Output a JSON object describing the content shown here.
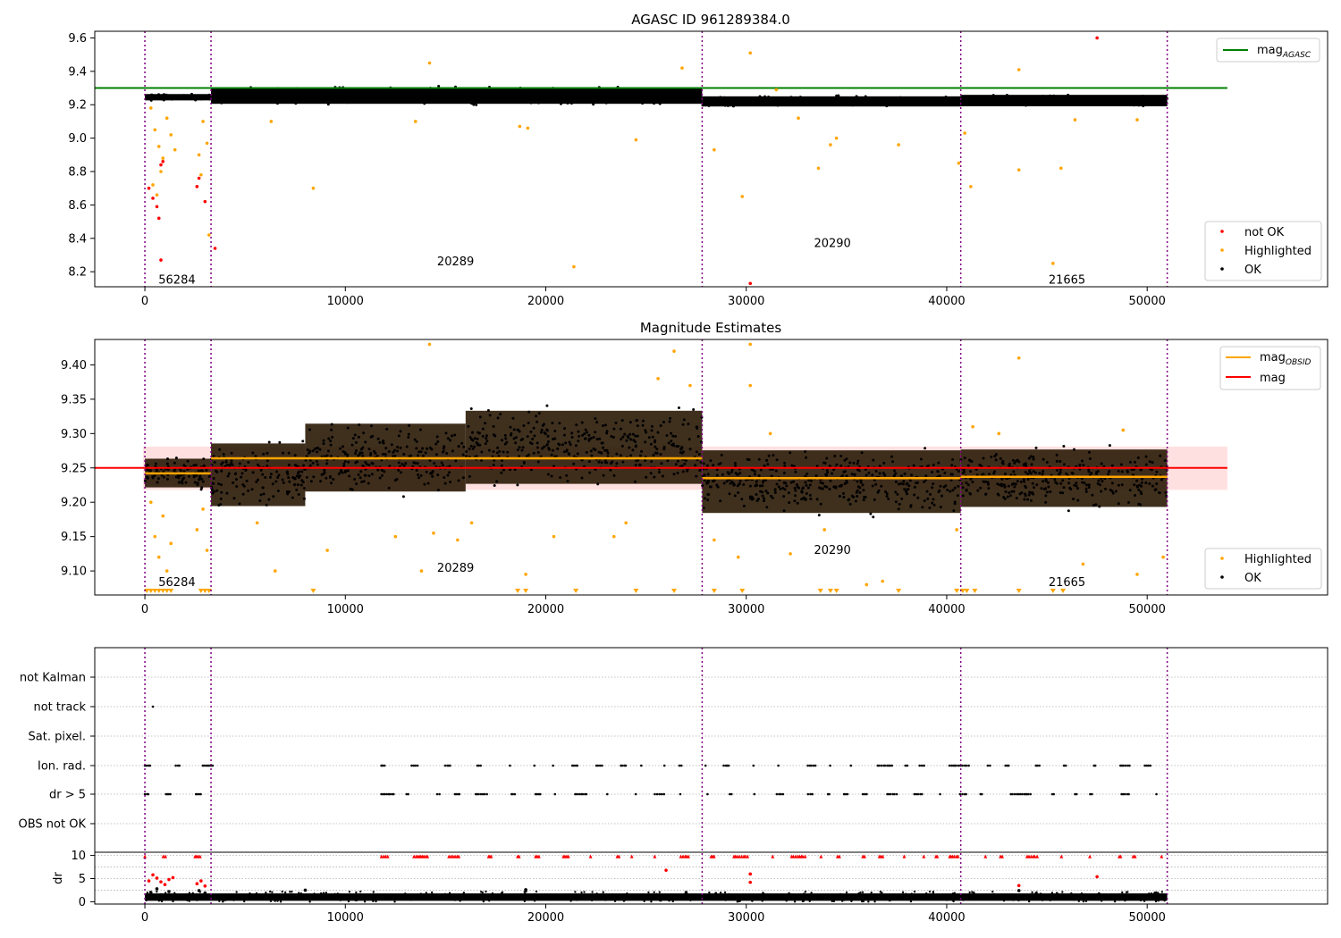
{
  "colors": {
    "ok": "#000000",
    "highlighted": "#ffa500",
    "not_ok": "#ff0000",
    "agasc_line": "#008000",
    "mag_line": "#ff0000",
    "mag_obsid_line": "#ffa500",
    "obs_boundary": "#800080",
    "grid": "#b0b0b0"
  },
  "chart_data": [
    {
      "type": "scatter",
      "title": "AGASC ID 961289384.0",
      "xlim": [
        -2500,
        59000
      ],
      "ylim": [
        8.11,
        9.64
      ],
      "xticks": [
        0,
        10000,
        20000,
        30000,
        40000,
        50000
      ],
      "yticks": [
        8.2,
        8.4,
        8.6,
        8.8,
        9.0,
        9.2,
        9.4,
        9.6
      ],
      "mag_agasc": 9.3,
      "obs_boundaries": [
        0,
        3300,
        27800,
        40700,
        51000
      ],
      "obs_labels": [
        {
          "text": "56284",
          "x": 1600,
          "y": 8.15
        },
        {
          "text": "20289",
          "x": 15500,
          "y": 8.26
        },
        {
          "text": "20290",
          "x": 34300,
          "y": 8.37
        },
        {
          "text": "21665",
          "x": 46000,
          "y": 8.15
        }
      ],
      "legend_top": [
        {
          "label": "mag",
          "sub": "AGASC"
        }
      ],
      "legend_bottom": [
        {
          "label": "not OK",
          "key": "not_ok"
        },
        {
          "label": "Highlighted",
          "key": "highlighted"
        },
        {
          "label": "OK",
          "key": "ok"
        }
      ],
      "ok_bands": [
        {
          "x0": 0,
          "x1": 3300,
          "ylo": 9.22,
          "yhi": 9.27
        },
        {
          "x0": 3300,
          "x1": 27800,
          "ylo": 9.19,
          "yhi": 9.32
        },
        {
          "x0": 27800,
          "x1": 40700,
          "ylo": 9.18,
          "yhi": 9.26
        },
        {
          "x0": 40700,
          "x1": 51000,
          "ylo": 9.18,
          "yhi": 9.27
        }
      ],
      "highlighted_points": [
        [
          300,
          9.18
        ],
        [
          500,
          9.05
        ],
        [
          700,
          8.95
        ],
        [
          900,
          8.88
        ],
        [
          1100,
          9.12
        ],
        [
          400,
          8.72
        ],
        [
          800,
          8.8
        ],
        [
          1300,
          9.02
        ],
        [
          600,
          8.66
        ],
        [
          1500,
          8.93
        ],
        [
          2700,
          8.9
        ],
        [
          2900,
          9.1
        ],
        [
          3100,
          8.97
        ],
        [
          2800,
          8.78
        ],
        [
          3200,
          8.42
        ],
        [
          6300,
          9.1
        ],
        [
          8400,
          8.7
        ],
        [
          13500,
          9.1
        ],
        [
          14200,
          9.45
        ],
        [
          18700,
          9.07
        ],
        [
          19100,
          9.06
        ],
        [
          21400,
          8.23
        ],
        [
          24500,
          8.99
        ],
        [
          26800,
          9.42
        ],
        [
          28400,
          8.93
        ],
        [
          29800,
          8.65
        ],
        [
          30200,
          9.51
        ],
        [
          31500,
          9.29
        ],
        [
          32600,
          9.12
        ],
        [
          33600,
          8.82
        ],
        [
          34200,
          8.96
        ],
        [
          34500,
          9.0
        ],
        [
          37600,
          8.96
        ],
        [
          40600,
          8.85
        ],
        [
          40900,
          9.03
        ],
        [
          41200,
          8.71
        ],
        [
          43600,
          9.41
        ],
        [
          43600,
          8.81
        ],
        [
          45300,
          8.25
        ],
        [
          45700,
          8.82
        ],
        [
          46400,
          9.11
        ],
        [
          49500,
          9.11
        ]
      ],
      "not_ok_points": [
        [
          200,
          8.7
        ],
        [
          400,
          8.64
        ],
        [
          600,
          8.59
        ],
        [
          700,
          8.52
        ],
        [
          800,
          8.84
        ],
        [
          900,
          8.86
        ],
        [
          800,
          8.27
        ],
        [
          2600,
          8.71
        ],
        [
          2700,
          8.76
        ],
        [
          3000,
          8.62
        ],
        [
          3500,
          8.34
        ],
        [
          30200,
          8.13
        ],
        [
          47500,
          9.6
        ]
      ]
    },
    {
      "type": "scatter",
      "title": "Magnitude Estimates",
      "xlim": [
        -2500,
        59000
      ],
      "ylim": [
        9.065,
        9.437
      ],
      "xticks": [
        0,
        10000,
        20000,
        30000,
        40000,
        50000
      ],
      "yticks": [
        9.1,
        9.15,
        9.2,
        9.25,
        9.3,
        9.35,
        9.4
      ],
      "mag": 9.25,
      "mag_band": [
        9.218,
        9.281
      ],
      "mag_obsid_segments": [
        {
          "x0": 0,
          "x1": 3300,
          "y": 9.242
        },
        {
          "x0": 3300,
          "x1": 27800,
          "y": 9.264
        },
        {
          "x0": 27800,
          "x1": 40700,
          "y": 9.235
        },
        {
          "x0": 40700,
          "x1": 51000,
          "y": 9.237
        }
      ],
      "obs_boundaries": [
        0,
        3300,
        27800,
        40700,
        51000
      ],
      "obs_labels": [
        {
          "text": "56284",
          "x": 1600,
          "y": 9.083
        },
        {
          "text": "20289",
          "x": 15500,
          "y": 9.104
        },
        {
          "text": "20290",
          "x": 34300,
          "y": 9.13
        },
        {
          "text": "21665",
          "x": 46000,
          "y": 9.083
        }
      ],
      "legend_top": [
        {
          "label": "mag",
          "sub": "OBSID",
          "key": "mag_obsid_line"
        },
        {
          "label": "mag",
          "sub": "",
          "key": "mag_line"
        }
      ],
      "legend_bottom": [
        {
          "label": "Highlighted",
          "key": "highlighted"
        },
        {
          "label": "OK",
          "key": "ok"
        }
      ],
      "ok_bands": [
        {
          "x0": 0,
          "x1": 3300,
          "ylo": 9.215,
          "yhi": 9.27
        },
        {
          "x0": 3300,
          "x1": 8000,
          "ylo": 9.18,
          "yhi": 9.3
        },
        {
          "x0": 8000,
          "x1": 16000,
          "ylo": 9.2,
          "yhi": 9.33
        },
        {
          "x0": 16000,
          "x1": 27800,
          "ylo": 9.21,
          "yhi": 9.35
        },
        {
          "x0": 27800,
          "x1": 40700,
          "ylo": 9.17,
          "yhi": 9.29
        },
        {
          "x0": 40700,
          "x1": 51000,
          "ylo": 9.18,
          "yhi": 9.29
        }
      ],
      "highlighted_points": [
        [
          300,
          9.2
        ],
        [
          500,
          9.15
        ],
        [
          700,
          9.12
        ],
        [
          900,
          9.18
        ],
        [
          1100,
          9.1
        ],
        [
          1300,
          9.14
        ],
        [
          2600,
          9.16
        ],
        [
          2900,
          9.19
        ],
        [
          3100,
          9.13
        ],
        [
          5600,
          9.17
        ],
        [
          6500,
          9.1
        ],
        [
          9100,
          9.13
        ],
        [
          12500,
          9.15
        ],
        [
          13800,
          9.1
        ],
        [
          14200,
          9.43
        ],
        [
          14400,
          9.155
        ],
        [
          15600,
          9.145
        ],
        [
          16300,
          9.17
        ],
        [
          19000,
          9.095
        ],
        [
          20400,
          9.15
        ],
        [
          23400,
          9.15
        ],
        [
          24000,
          9.17
        ],
        [
          25600,
          9.38
        ],
        [
          26400,
          9.42
        ],
        [
          27200,
          9.37
        ],
        [
          28400,
          9.145
        ],
        [
          29600,
          9.12
        ],
        [
          30200,
          9.43
        ],
        [
          30200,
          9.37
        ],
        [
          31200,
          9.3
        ],
        [
          32200,
          9.125
        ],
        [
          33900,
          9.16
        ],
        [
          36000,
          9.08
        ],
        [
          36800,
          9.085
        ],
        [
          40500,
          9.16
        ],
        [
          41300,
          9.31
        ],
        [
          42600,
          9.3
        ],
        [
          43600,
          9.41
        ],
        [
          46800,
          9.11
        ],
        [
          48800,
          9.305
        ],
        [
          49500,
          9.095
        ],
        [
          50800,
          9.12
        ]
      ],
      "clip_markers": [
        100,
        300,
        500,
        700,
        900,
        1100,
        1300,
        2800,
        3000,
        3200,
        8400,
        18600,
        19000,
        21500,
        24500,
        26400,
        28400,
        29800,
        33700,
        34200,
        34500,
        37600,
        40500,
        40800,
        41000,
        41400,
        43600,
        45300,
        45800
      ]
    },
    {
      "type": "scatter",
      "title": "",
      "xlim": [
        -2500,
        59000
      ],
      "xticks": [
        0,
        10000,
        20000,
        30000,
        40000,
        50000
      ],
      "flag_categories": [
        "not Kalman",
        "not track",
        "Sat. pixel.",
        "Ion. rad.",
        "dr > 5",
        "OBS not OK"
      ],
      "flag_points": [
        {
          "flag": "not track",
          "x": [
            400
          ]
        },
        {
          "flag": "Ion. rad.",
          "ranges": [
            [
              0,
              3700
            ],
            [
              11800,
              51000
            ]
          ]
        },
        {
          "flag": "dr > 5",
          "ranges": [
            [
              0,
              3700
            ],
            [
              11800,
              51000
            ]
          ]
        }
      ],
      "dr_ylabel": "dr",
      "dr_yticks": [
        0,
        5,
        10
      ],
      "dr_ylim": [
        -0.5,
        10.5
      ],
      "dr_ok_band": {
        "x0": 0,
        "x1": 51000,
        "ylo": 0.2,
        "yhi": 1.8
      },
      "dr_saturated_y": 9.8,
      "dr_saturated_ranges": [
        [
          0,
          3700
        ],
        [
          11800,
          51000
        ]
      ],
      "dr_red_points": [
        [
          200,
          4.5
        ],
        [
          400,
          5.8
        ],
        [
          600,
          5.1
        ],
        [
          800,
          4.3
        ],
        [
          1000,
          3.7
        ],
        [
          1200,
          4.8
        ],
        [
          1400,
          5.2
        ],
        [
          2600,
          3.9
        ],
        [
          2800,
          4.5
        ],
        [
          3000,
          3.4
        ],
        [
          26000,
          6.8
        ],
        [
          30200,
          6.0
        ],
        [
          30200,
          4.2
        ],
        [
          43600,
          3.5
        ],
        [
          47500,
          5.4
        ]
      ],
      "dr_black_points": [
        [
          300,
          2.0
        ],
        [
          600,
          2.8
        ],
        [
          800,
          1.5
        ],
        [
          1200,
          2.2
        ],
        [
          2700,
          2.4
        ],
        [
          3000,
          1.9
        ],
        [
          8000,
          2.5
        ],
        [
          19000,
          2.6
        ],
        [
          27000,
          2.0
        ],
        [
          43600,
          2.4
        ]
      ]
    }
  ]
}
